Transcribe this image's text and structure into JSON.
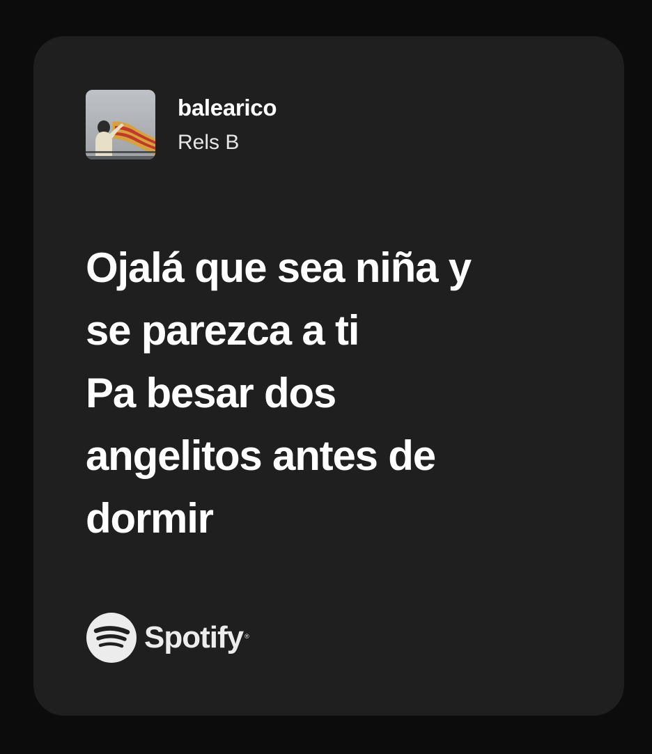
{
  "card": {
    "song_title": "balearico",
    "artist": "Rels B",
    "lyrics": [
      "Ojalá que sea niña y",
      "se parezca a ti",
      "Pa besar dos",
      "angelitos antes de",
      "dormir"
    ],
    "brand": {
      "icon": "spotify-logo-icon",
      "name": "Spotify",
      "registered_mark": "®"
    }
  },
  "colors": {
    "page_background": "#0c0c0c",
    "card_background": "#201f20",
    "text": "#ffffff"
  }
}
